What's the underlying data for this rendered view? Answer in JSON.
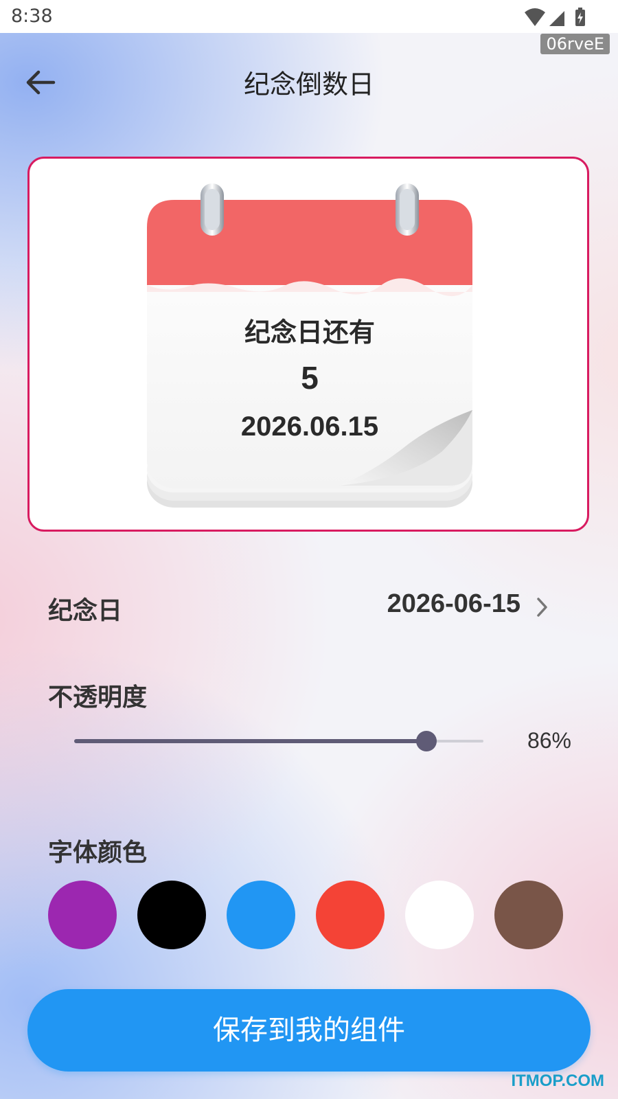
{
  "status_bar": {
    "time": "8:38",
    "icons": [
      "wifi-icon",
      "cell-signal-icon",
      "battery-charging-icon"
    ]
  },
  "build_tag": "06rveE",
  "header": {
    "title": "纪念倒数日",
    "back_icon": "arrow-left-icon"
  },
  "preview": {
    "label": "纪念日还有",
    "days": "5",
    "date": "2026.06.15",
    "border_color": "#d81b60",
    "calendar_header_color": "#f26666"
  },
  "anniversary": {
    "label": "纪念日",
    "value": "2026-06-15",
    "chevron_icon": "chevron-right-icon"
  },
  "opacity": {
    "label": "不透明度",
    "value_text": "86%",
    "value": 0.86
  },
  "font_color": {
    "label": "字体颜色",
    "colors": [
      "#9c27b0",
      "#000000",
      "#2196f3",
      "#f44336",
      "#ffffff",
      "#795548"
    ]
  },
  "save_button": {
    "label": "保存到我的组件",
    "color": "#2196f3"
  },
  "watermark": "ITMOP.COM"
}
